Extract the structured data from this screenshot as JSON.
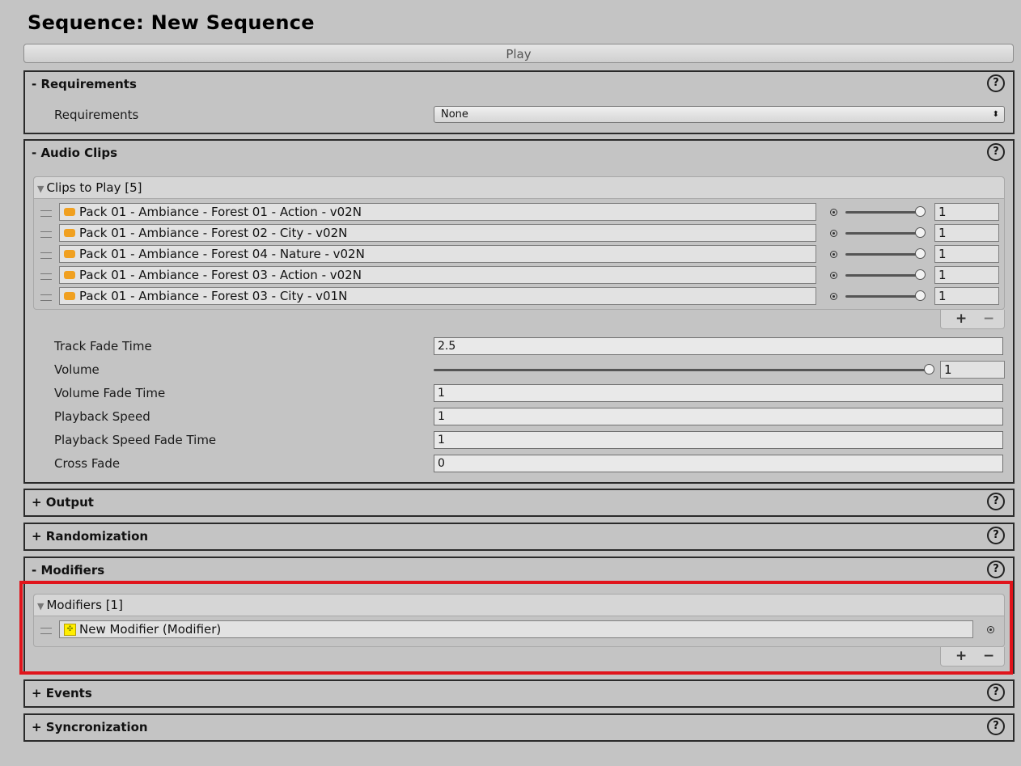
{
  "title": "Sequence: New Sequence",
  "play_label": "Play",
  "help_glyph": "?",
  "requirements": {
    "header": "- Requirements",
    "label": "Requirements",
    "value": "None",
    "arrow": "⬍"
  },
  "audio_clips": {
    "header": "- Audio Clips",
    "list_title": "Clips to Play [5]",
    "clips": [
      {
        "name": "Pack 01 - Ambiance - Forest 01 - Action - v02N",
        "weight": "1",
        "weight_level": 1.0
      },
      {
        "name": "Pack 01 - Ambiance - Forest 02 - City - v02N",
        "weight": "1",
        "weight_level": 1.0
      },
      {
        "name": "Pack 01 - Ambiance - Forest 04 - Nature - v02N",
        "weight": "1",
        "weight_level": 1.0
      },
      {
        "name": "Pack 01 - Ambiance - Forest 03 - Action - v02N",
        "weight": "1",
        "weight_level": 1.0
      },
      {
        "name": "Pack 01 - Ambiance - Forest 03 - City - v01N",
        "weight": "1",
        "weight_level": 1.0
      }
    ],
    "plus": "+",
    "minus": "−",
    "props": {
      "track_fade_time_label": "Track Fade Time",
      "track_fade_time_value": "2.5",
      "volume_label": "Volume",
      "volume_value": "1",
      "volume_level": 1.0,
      "volume_fade_time_label": "Volume Fade Time",
      "volume_fade_time_value": "1",
      "playback_speed_label": "Playback Speed",
      "playback_speed_value": "1",
      "playback_speed_fade_time_label": "Playback Speed Fade Time",
      "playback_speed_fade_time_value": "1",
      "cross_fade_label": "Cross Fade",
      "cross_fade_value": "0"
    }
  },
  "output": {
    "header": "+ Output"
  },
  "randomization": {
    "header": "+ Randomization"
  },
  "modifiers": {
    "header": "- Modifiers",
    "list_title": "Modifiers [1]",
    "items": [
      {
        "name": "New Modifier (Modifier)"
      }
    ],
    "plus": "+",
    "minus": "−"
  },
  "events": {
    "header": "+ Events"
  },
  "syncronization": {
    "header": "+ Syncronization"
  },
  "colors": {
    "highlight": "#e0141b",
    "audio_icon": "#f0a020",
    "modifier_icon": "#ffee00"
  }
}
